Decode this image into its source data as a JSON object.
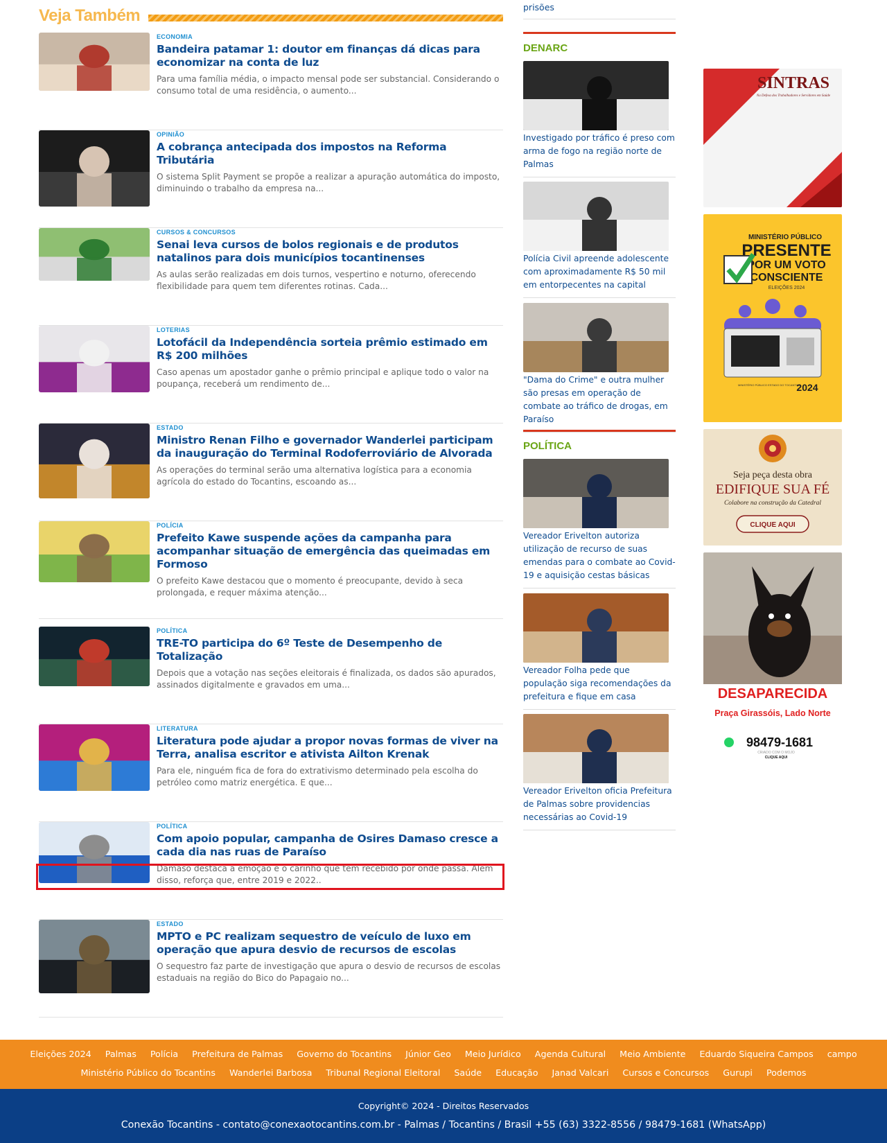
{
  "main": {
    "section_title": "Veja Também",
    "articles": [
      {
        "category": "ECONOMIA",
        "title": "Bandeira patamar 1: doutor em finanças dá dicas para economizar na conta de luz",
        "desc": "Para uma família média, o impacto mensal pode ser substancial. Considerando o consumo total de uma residência, o aumento..."
      },
      {
        "category": "OPINIÃO",
        "title": "A cobrança antecipada dos impostos na Reforma Tributária",
        "desc": "O sistema Split Payment se propõe a realizar a apuração automática do imposto, diminuindo o trabalho da empresa na..."
      },
      {
        "category": "CURSOS & CONCURSOS",
        "title": "Senai leva cursos de bolos regionais e de produtos natalinos para dois municípios tocantinenses",
        "desc": "As aulas serão realizadas em dois turnos, vespertino e noturno, oferecendo flexibilidade para quem tem diferentes rotinas. Cada..."
      },
      {
        "category": "LOTERIAS",
        "title": "Lotofácil da Independência sorteia prêmio estimado em R$ 200 milhões",
        "desc": "Caso apenas um apostador ganhe o prêmio principal e aplique todo o valor na poupança, receberá um rendimento de..."
      },
      {
        "category": "ESTADO",
        "title": "Ministro Renan Filho e governador Wanderlei participam da inauguração do Terminal Rodoferroviário de Alvorada",
        "desc": "As operações do terminal serão uma alternativa logística para a economia agrícola do estado do Tocantins, escoando as..."
      },
      {
        "category": "POLÍCIA",
        "title": "Prefeito Kawe suspende ações da campanha para acompanhar situação de emergência das queimadas em Formoso",
        "desc": "O prefeito Kawe destacou que o momento é preocupante, devido à seca prolongada, e requer máxima atenção..."
      },
      {
        "category": "POLÍTICA",
        "title": "TRE-TO participa do 6º Teste de Desempenho de Totalização",
        "desc": "Depois que a votação nas seções eleitorais é finalizada, os dados são apurados, assinados digitalmente e gravados em uma..."
      },
      {
        "category": "LITERATURA",
        "title": "Literatura pode ajudar a propor novas formas de viver na Terra, analisa escritor e ativista Ailton Krenak",
        "desc": "Para ele, ninguém fica de fora do extrativismo determinado pela escolha do petróleo como matriz energética. E que..."
      },
      {
        "category": "POLÍTICA",
        "title": "Com apoio popular, campanha de Osires Damaso cresce a cada dia nas ruas de Paraíso",
        "desc": "Damaso destaca a emoção e o carinho que tem recebido por onde passa. Além disso, reforça que, entre 2019 e 2022.."
      },
      {
        "category": "ESTADO",
        "title": "MPTO e PC realizam sequestro de veículo de luxo em operação que apura desvio de recursos de escolas",
        "desc": "O sequestro faz parte de investigação que apura o desvio de recursos de escolas estaduais na região do Bico do Papagaio no..."
      }
    ]
  },
  "sidebar": {
    "previous_text": "prisões",
    "denarc": {
      "title": "DENARC",
      "items": [
        {
          "text": "Investigado por tráfico é preso com arma de fogo na região norte de Palmas"
        },
        {
          "text": "Polícia Civil apreende adolescente com aproximadamente R$ 50 mil em entorpecentes na capital"
        },
        {
          "text": "\"Dama do Crime\" e outra mulher são presas em operação de combate ao tráfico de drogas, em Paraíso"
        }
      ]
    },
    "politica": {
      "title": "POLÍTICA",
      "items": [
        {
          "text": "Vereador Erivelton autoriza utilização de recurso de suas emendas para o combate ao Covid-19 e aquisição cestas básicas"
        },
        {
          "text": "Vereador Folha pede que população siga recomendações da prefeitura e fique em casa"
        },
        {
          "text": "Vereador Erivelton oficia Prefeitura de Palmas sobre providencias necessárias ao Covid-19"
        }
      ]
    }
  },
  "ads": {
    "sintras": {
      "brand": "SINTRAS",
      "tagline": "Na Defesa dos Trabalhadores e Servidores em Saúde"
    },
    "mp": {
      "line1": "MINISTÉRIO PÚBLICO",
      "line2": "PRESENTE",
      "line3": "POR UM VOTO",
      "line4": "CONSCIENTE",
      "line5": "ELEIÇÕES 2024",
      "foot_left": "MINISTÉRIO PÚBLICO ESTADO DO TOCANTINS",
      "foot_right": "2024"
    },
    "catedral": {
      "line1": "Seja peça desta obra",
      "line2": "EDIFIQUE SUA FÉ",
      "line3": "Colabore na construção da Catedral",
      "button": "CLIQUE AQUI"
    },
    "desaparecida": {
      "title": "DESAPARECIDA",
      "place": "Praça Girassóis, Lado Norte",
      "phone": "98479-1681",
      "small": "CRIADO COM O MOJO",
      "click": "CLIQUE AQUI"
    }
  },
  "footer": {
    "tags_row1": [
      "Eleições 2024",
      "Palmas",
      "Polícia",
      "Prefeitura de Palmas",
      "Governo do Tocantins",
      "Júnior Geo",
      "Meio Jurídico",
      "Agenda Cultural",
      "Meio Ambiente",
      "Eduardo Siqueira Campos",
      "campo"
    ],
    "tags_row2": [
      "Ministério Público do Tocantins",
      "Wanderlei Barbosa",
      "Tribunal Regional Eleitoral",
      "Saúde",
      "Educação",
      "Janad Valcari",
      "Cursos e Concursos",
      "Gurupi",
      "Podemos"
    ],
    "copyright": "Copyright© 2024 - Direitos Reservados",
    "contact": "Conexão Tocantins - contato@conexaotocantins.com.br - Palmas / Tocantins / Brasil +55 (63) 3322-8556 / 98479-1681 (WhatsApp)"
  },
  "colors": {
    "accent_orange": "#f08c1e",
    "footer_blue": "#0b3f86",
    "title_blue": "#0f4c8f",
    "category_blue": "#1f8fd0",
    "section_green": "#6aa515",
    "highlight_red": "#e0141e"
  }
}
